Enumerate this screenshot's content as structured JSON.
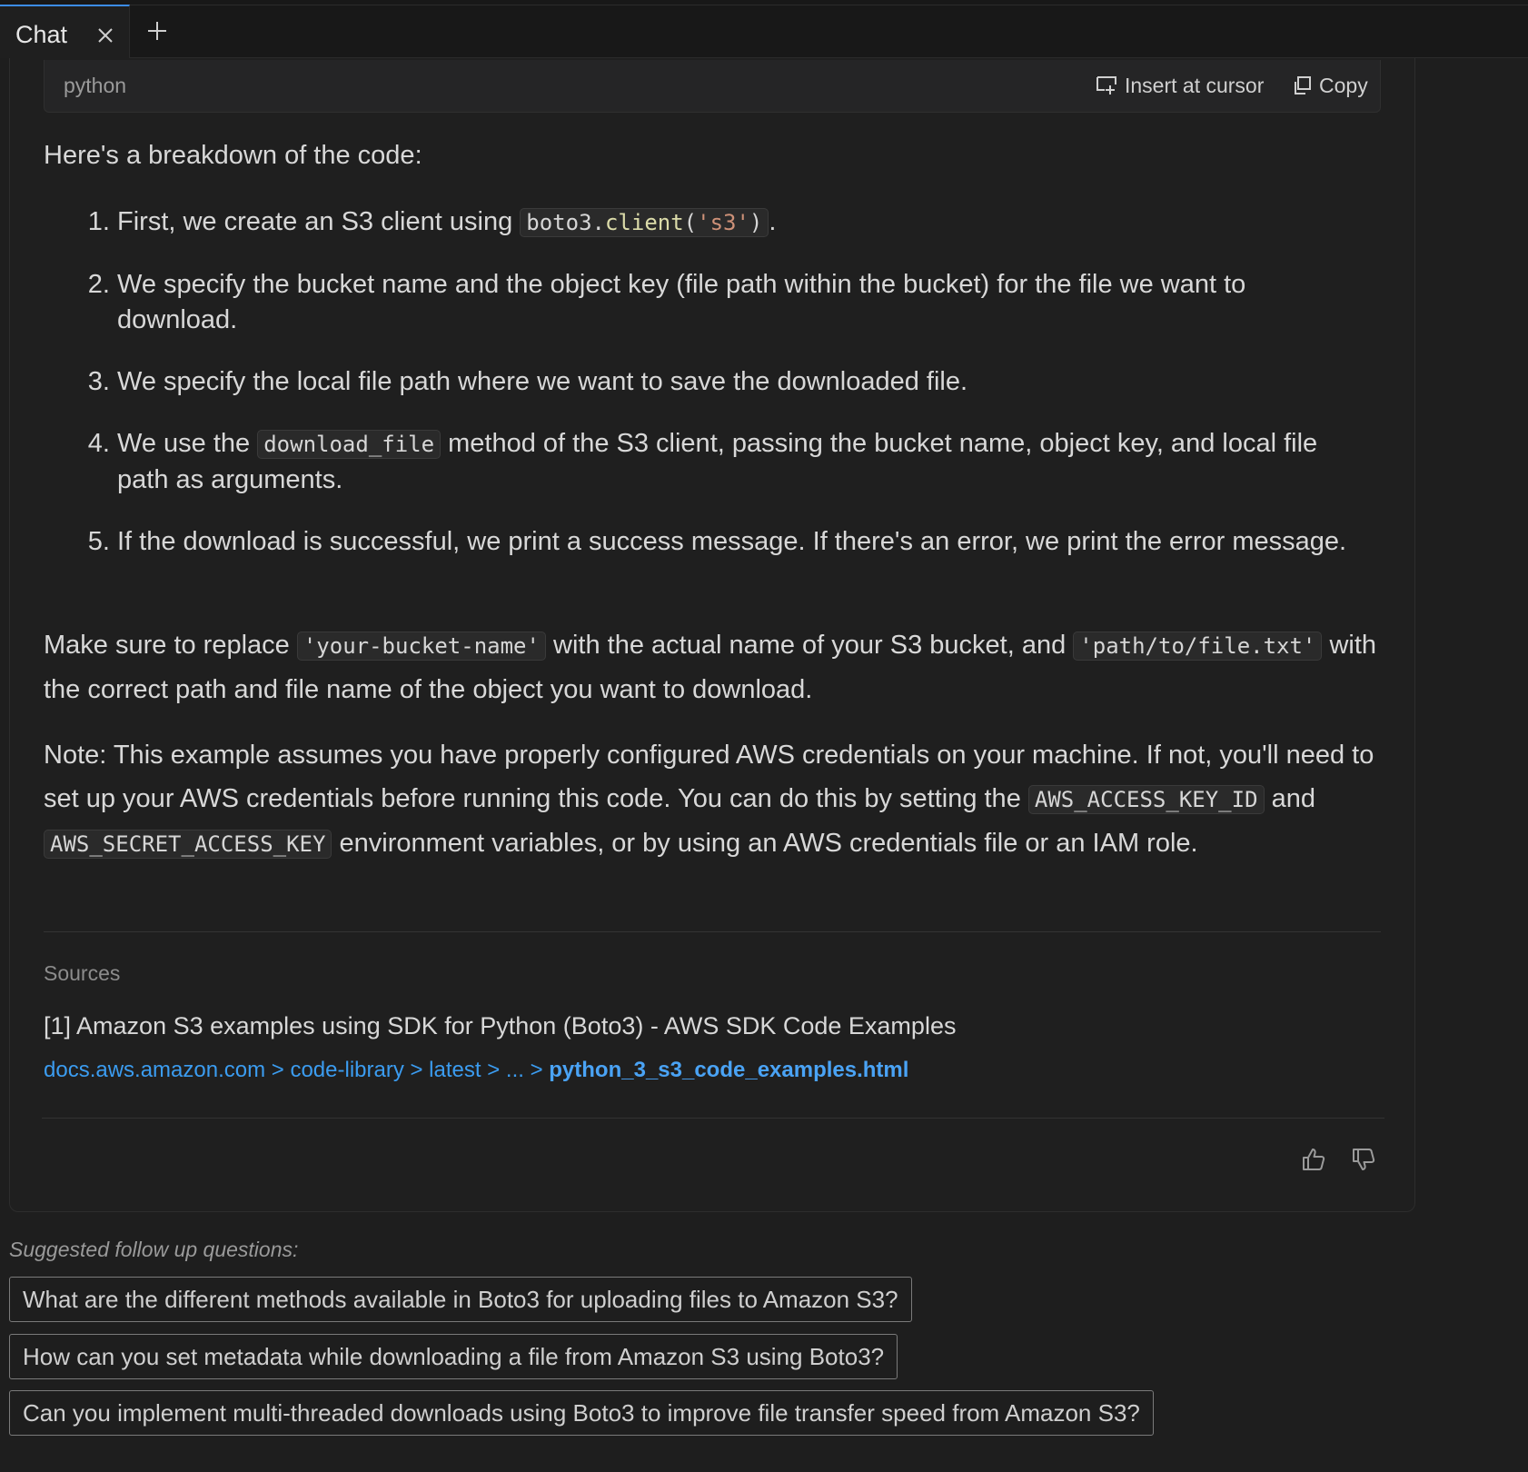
{
  "tab": {
    "label": "Chat"
  },
  "code_block": {
    "language": "python",
    "insert_label": "Insert at cursor",
    "copy_label": "Copy"
  },
  "message": {
    "intro": "Here's a breakdown of the code:",
    "steps": [
      {
        "before": "First, we create an S3 client using ",
        "code_parts": [
          "boto3.",
          "client",
          "(",
          "'s3'",
          ")"
        ],
        "after": "."
      },
      {
        "text": "We specify the bucket name and the object key (file path within the bucket) for the file we want to download."
      },
      {
        "text": "We specify the local file path where we want to save the downloaded file."
      },
      {
        "before": "We use the ",
        "code": "download_file",
        "after": " method of the S3 client, passing the bucket name, object key, and local file path as arguments."
      },
      {
        "text": "If the download is successful, we print a success message. If there's an error, we print the error message."
      }
    ],
    "replace_note": {
      "t1": "Make sure to replace ",
      "c1": "'your-bucket-name'",
      "t2": " with the actual name of your S3 bucket, and ",
      "c2": "'path/to/file.txt'",
      "t3": " with the correct path and file name of the object you want to download."
    },
    "aws_note": {
      "t1": "Note: This example assumes you have properly configured AWS credentials on your machine. If not, you'll need to set up your AWS credentials before running this code. You can do this by setting the ",
      "c1": "AWS_ACCESS_KEY_ID",
      "t2": " and ",
      "c2": "AWS_SECRET_ACCESS_KEY",
      "t3": " environment variables, or by using an AWS credentials file or an IAM role."
    }
  },
  "sources": {
    "heading": "Sources",
    "items": [
      {
        "title": "[1] Amazon S3 examples using SDK for Python (Boto3) - AWS SDK Code Examples",
        "breadcrumb": "docs.aws.amazon.com > code-library > latest > ... > ",
        "page": "python_3_s3_code_examples.html"
      }
    ]
  },
  "suggestions": {
    "heading": "Suggested follow up questions:",
    "items": [
      "What are the different methods available in Boto3 for uploading files to Amazon S3?",
      "How can you set metadata while downloading a file from Amazon S3 using Boto3?",
      "Can you implement multi-threaded downloads using Boto3 to improve file transfer speed from Amazon S3?"
    ]
  },
  "icons": {
    "tab_close": "close-icon",
    "tab_add": "plus-icon",
    "insert": "insert-at-cursor-icon",
    "copy": "copy-icon",
    "thumbs_up": "thumbs-up-icon",
    "thumbs_down": "thumbs-down-icon"
  },
  "colors": {
    "accent": "#3c8ce7",
    "link": "#3b9cf0",
    "background": "#1e1e1e"
  }
}
